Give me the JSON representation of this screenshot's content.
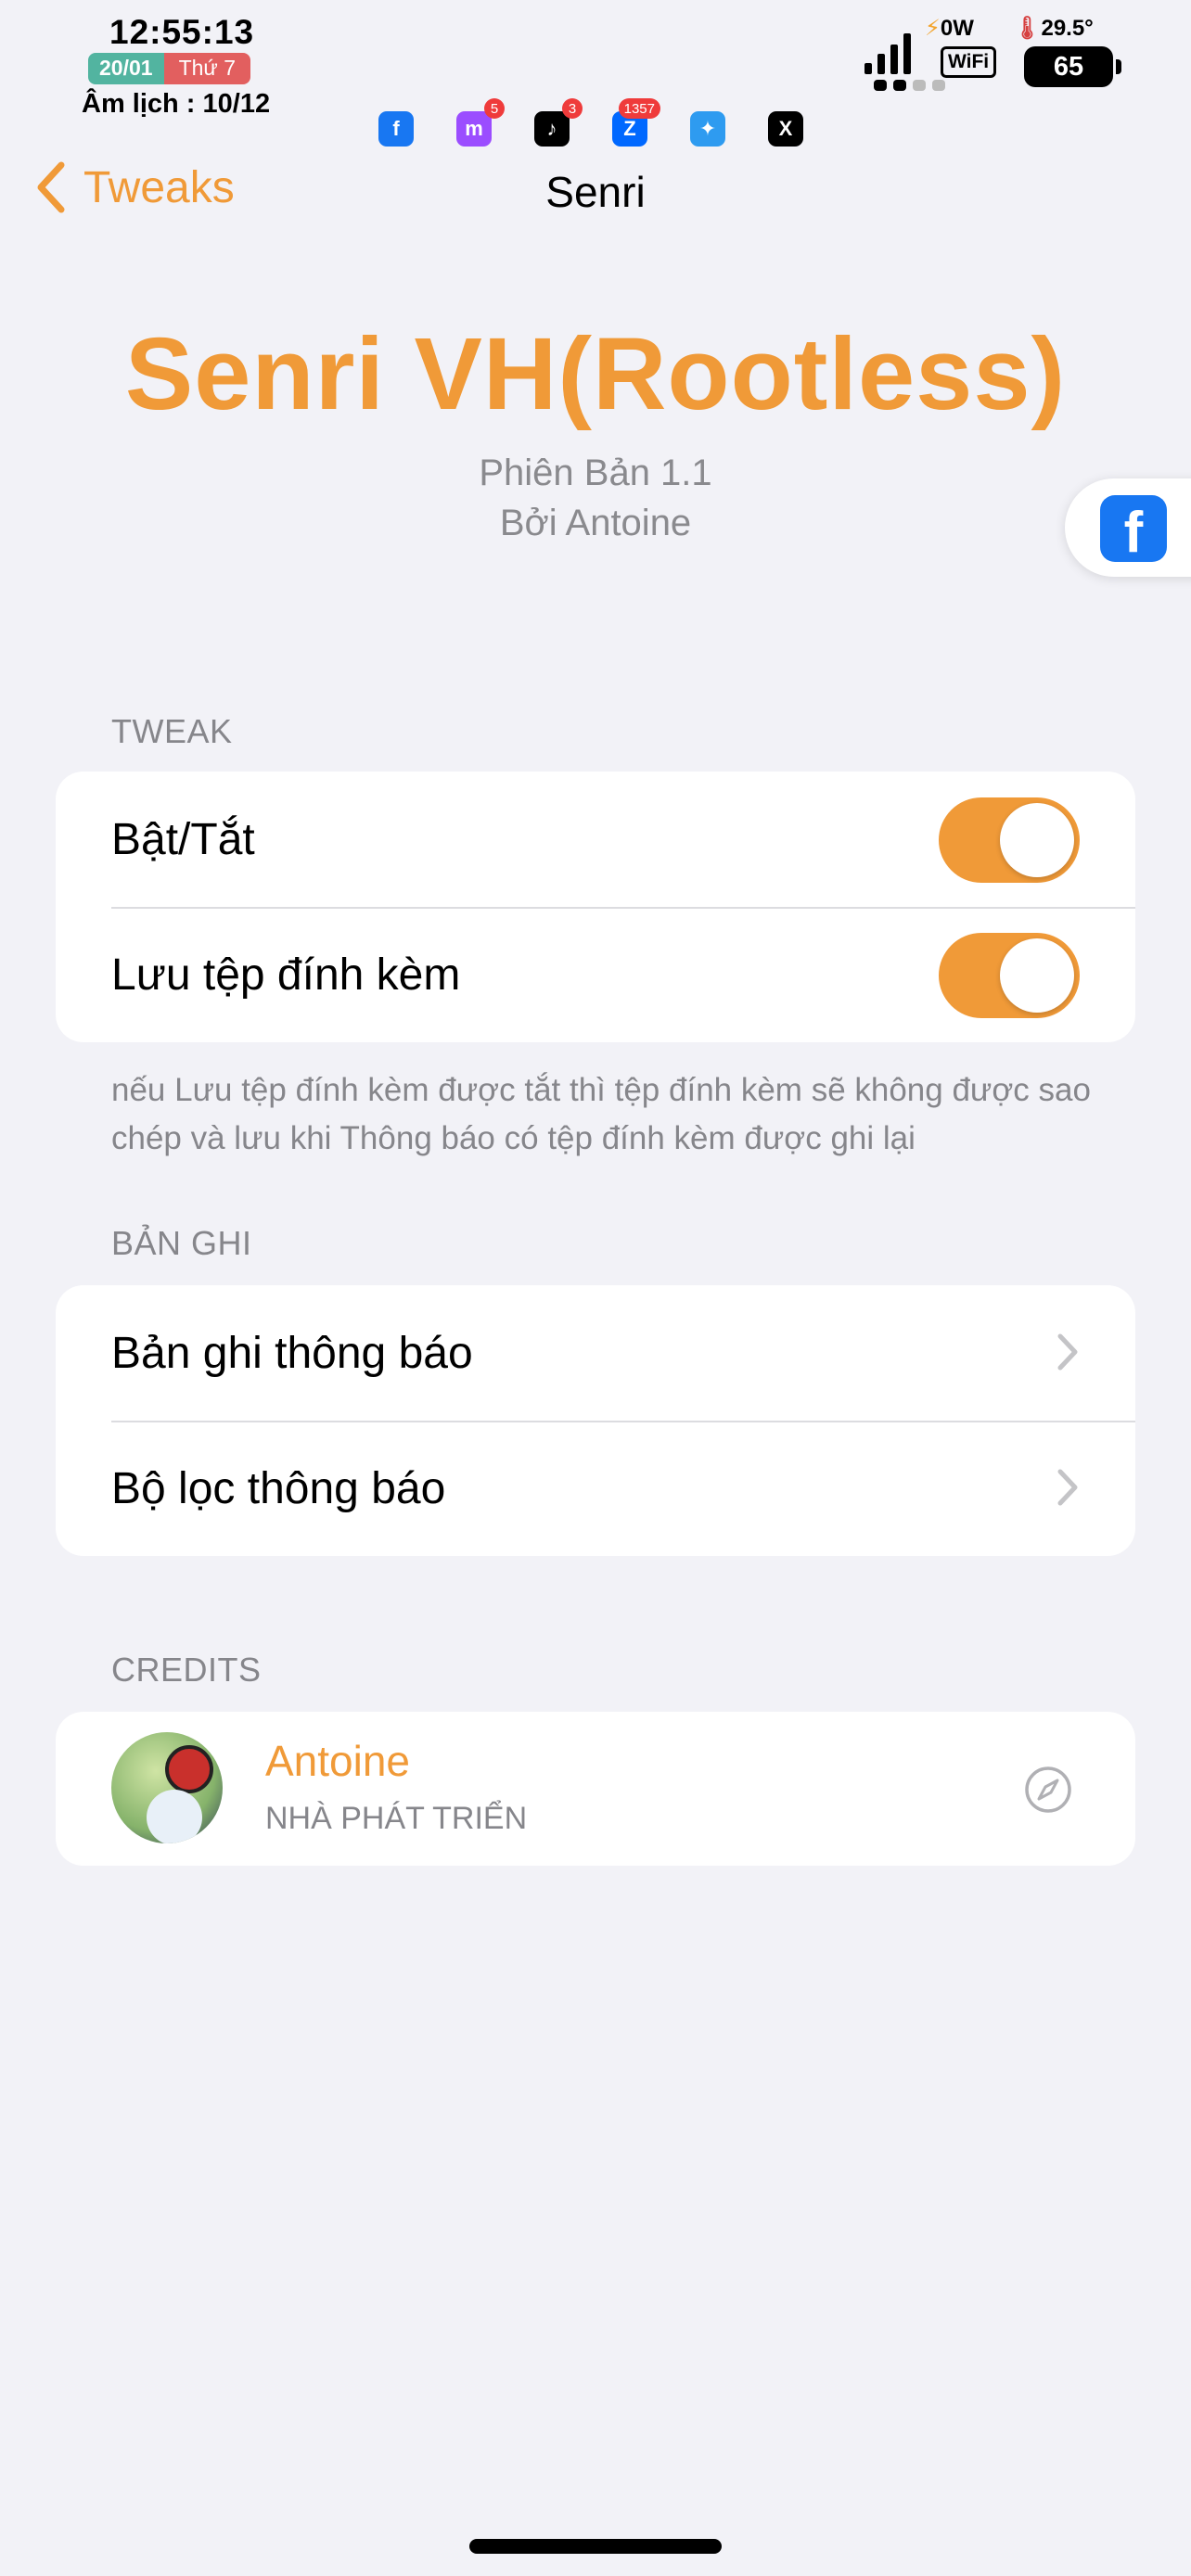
{
  "status_bar": {
    "time": "12:55:13",
    "date": "20/01",
    "weekday": "Thứ 7",
    "lunar": "Âm lịch : 10/12",
    "power": "0W",
    "temperature": "29.5°",
    "wifi_label": "WiFi",
    "battery": "65",
    "app_icons": [
      {
        "name": "facebook-icon",
        "glyph": "f",
        "bg": "#1877f2",
        "badge": ""
      },
      {
        "name": "messenger-icon",
        "glyph": "m",
        "bg": "#9b4dff",
        "badge": "5"
      },
      {
        "name": "tiktok-icon",
        "glyph": "♪",
        "bg": "#000000",
        "badge": "3"
      },
      {
        "name": "zalo-icon",
        "glyph": "Z",
        "bg": "#0068ff",
        "badge": "1357"
      },
      {
        "name": "safari-icon",
        "glyph": "✦",
        "bg": "#2e9bf0",
        "badge": ""
      },
      {
        "name": "x-icon",
        "glyph": "X",
        "bg": "#000000",
        "badge": ""
      }
    ]
  },
  "nav": {
    "back_label": "Tweaks",
    "title": "Senri"
  },
  "header": {
    "title": "Senri VH(Rootless)",
    "version": "Phiên Bản 1.1",
    "author": "Bởi Antoine"
  },
  "sections": {
    "tweak": {
      "label": "TWEAK",
      "items": [
        {
          "label": "Bật/Tắt",
          "enabled": true
        },
        {
          "label": "Lưu tệp đính kèm",
          "enabled": true
        }
      ],
      "footer": "nếu Lưu tệp đính kèm được tắt thì tệp đính kèm sẽ không được sao chép và lưu khi Thông báo có tệp đính kèm được ghi lại"
    },
    "logs": {
      "label": "BẢN GHI",
      "items": [
        {
          "label": "Bản ghi thông báo"
        },
        {
          "label": "Bộ lọc thông báo"
        }
      ]
    },
    "credits": {
      "label": "CREDITS",
      "name": "Antoine",
      "role": "NHÀ PHÁT TRIỂN"
    }
  },
  "colors": {
    "accent": "#f09a38",
    "background": "#f2f2f7",
    "secondary_text": "#86868b"
  }
}
